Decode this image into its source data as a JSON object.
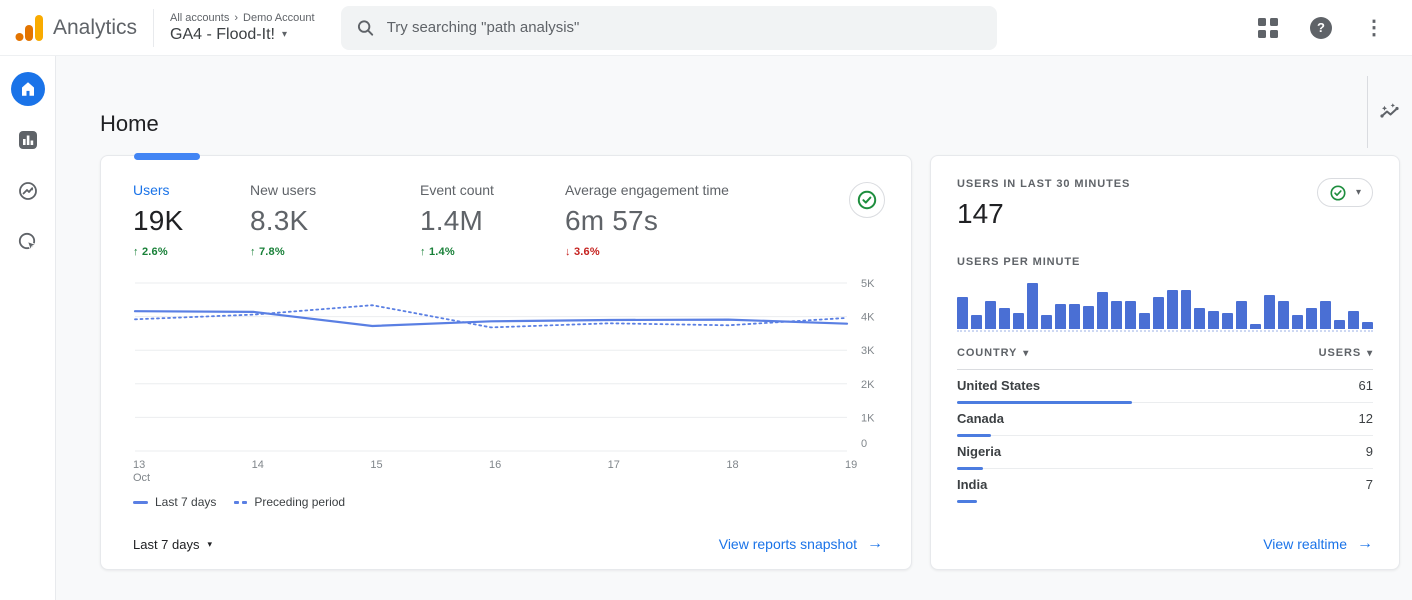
{
  "header": {
    "brand": "Analytics",
    "breadcrumb": {
      "level1": "All accounts",
      "separator": "›",
      "level2": "Demo Account"
    },
    "property": "GA4 - Flood-It!",
    "caret": "▾",
    "search": {
      "placeholder": "Try searching \"path analysis\""
    }
  },
  "sidebar": {
    "items": [
      "home",
      "reports",
      "explore",
      "advertising"
    ]
  },
  "page": {
    "title": "Home"
  },
  "summary_card": {
    "metrics": [
      {
        "label": "Users",
        "value": "19K",
        "arrow": "↑",
        "delta": "2.6%",
        "direction": "up"
      },
      {
        "label": "New users",
        "value": "8.3K",
        "arrow": "↑",
        "delta": "7.8%",
        "direction": "up"
      },
      {
        "label": "Event count",
        "value": "1.4M",
        "arrow": "↑",
        "delta": "1.4%",
        "direction": "up"
      },
      {
        "label": "Average engagement time",
        "value": "6m 57s",
        "arrow": "↓",
        "delta": "3.6%",
        "direction": "down"
      }
    ],
    "range_label": "Last 7 days",
    "caret": "▾",
    "link": "View reports snapshot",
    "link_arrow": "→"
  },
  "realtime_card": {
    "title": "USERS IN LAST 30 MINUTES",
    "value": "147",
    "per_minute_label": "USERS PER MINUTE",
    "caret": "▾",
    "table": {
      "col1": "COUNTRY",
      "col2": "USERS",
      "sort_caret": "▾",
      "max_users": 61,
      "rows": [
        {
          "name": "United States",
          "users": 61
        },
        {
          "name": "Canada",
          "users": 12
        },
        {
          "name": "Nigeria",
          "users": 9
        },
        {
          "name": "India",
          "users": 7
        }
      ]
    },
    "link": "View realtime",
    "link_arrow": "→"
  },
  "chart_data": [
    {
      "type": "line",
      "title": "Users, last 7 days vs preceding period",
      "x_labels": [
        "13",
        "14",
        "15",
        "16",
        "17",
        "18",
        "19"
      ],
      "x_sublabel": "Oct",
      "series": [
        {
          "name": "Last 7 days",
          "style": "solid",
          "values": [
            4160,
            4140,
            3720,
            3860,
            3900,
            3910,
            3790
          ]
        },
        {
          "name": "Preceding period",
          "style": "dotted",
          "values": [
            3920,
            4060,
            4340,
            3680,
            3800,
            3740,
            3960
          ]
        }
      ],
      "ylim": [
        0,
        5000
      ],
      "y_ticks": [
        {
          "v": 5000,
          "label": "5K"
        },
        {
          "v": 4000,
          "label": "4K"
        },
        {
          "v": 3000,
          "label": "3K"
        },
        {
          "v": 2000,
          "label": "2K"
        },
        {
          "v": 1000,
          "label": "1K"
        },
        {
          "v": 0,
          "label": "0"
        }
      ],
      "grid": true,
      "legend_position": "bottom"
    },
    {
      "type": "bar",
      "title": "USERS PER MINUTE",
      "values": [
        7,
        3,
        6,
        4.5,
        3.5,
        10,
        3,
        5.5,
        5.5,
        5,
        8,
        6,
        6,
        3.5,
        7,
        8.5,
        8.5,
        4.5,
        4,
        3.5,
        6,
        1,
        7.5,
        6,
        3,
        4.5,
        6,
        2,
        4,
        1.5
      ],
      "ylim": [
        0,
        10
      ]
    }
  ],
  "colors": {
    "accent": "#1a73e8",
    "chart_line": "#5a7fe3",
    "realtime_bar": "#4a6fd4",
    "positive": "#188038",
    "negative": "#c5221f",
    "grid": "#ebedef",
    "tick_text": "#80868b"
  }
}
